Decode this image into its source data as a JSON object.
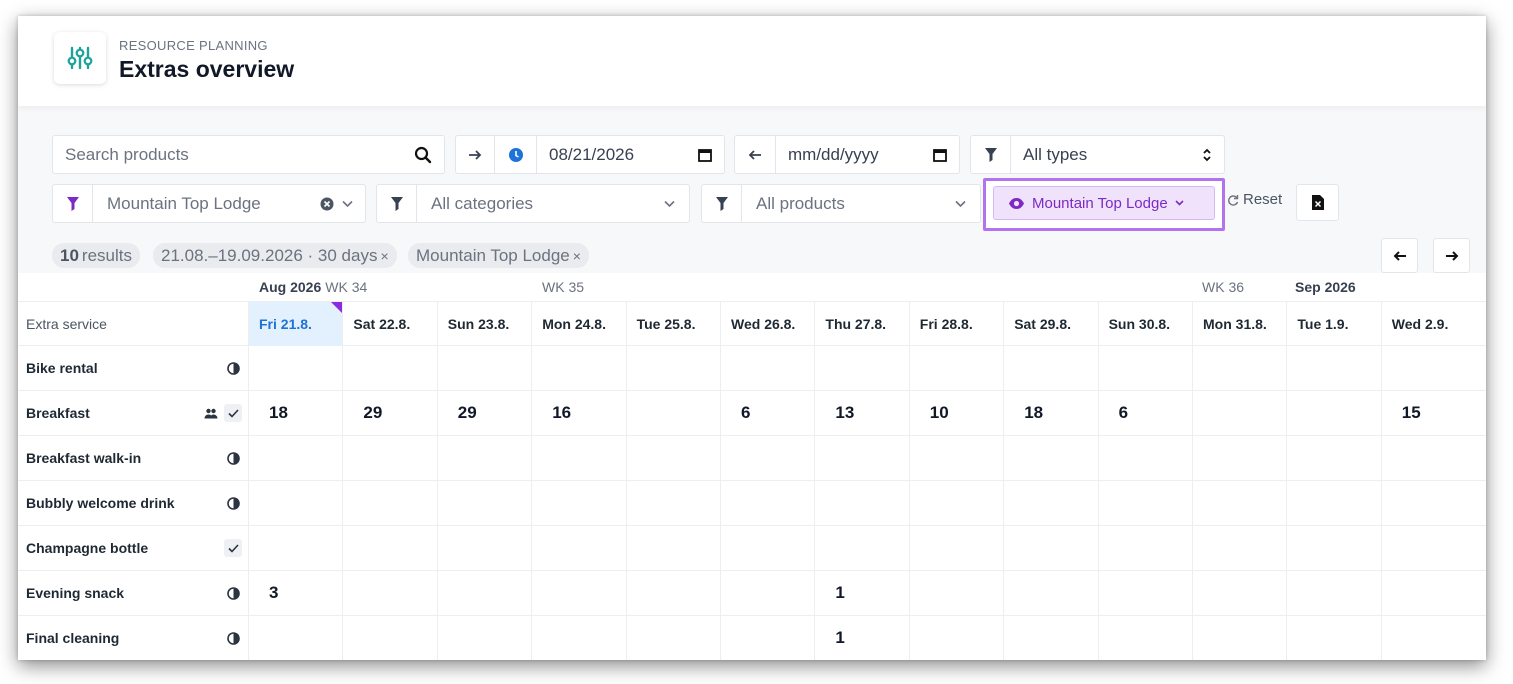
{
  "header": {
    "eyebrow": "RESOURCE PLANNING",
    "title": "Extras overview"
  },
  "filters": {
    "search_placeholder": "Search products",
    "from_date": "08/21/2026",
    "to_date_placeholder": "mm/dd/yyyy",
    "type_select": "All types",
    "property": "Mountain Top Lodge",
    "category_select": "All categories",
    "product_select": "All products",
    "view_button": "Mountain Top Lodge",
    "reset_label": "Reset"
  },
  "summary": {
    "count": "10",
    "results_label": "results",
    "date_range_tag": "21.08.–19.09.2026 · 30 days",
    "property_tag": "Mountain Top Lodge",
    "remove_glyph": "×"
  },
  "timeline": {
    "months": [
      {
        "month": "Aug 2026",
        "week": "WK 34"
      },
      {
        "month": "",
        "week": "WK 35"
      },
      {
        "month": "",
        "week": "WK 36"
      },
      {
        "month": "Sep 2026",
        "week": ""
      }
    ],
    "row_header": "Extra service",
    "days": [
      "Fri 21.8.",
      "Sat 22.8.",
      "Sun 23.8.",
      "Mon 24.8.",
      "Tue 25.8.",
      "Wed 26.8.",
      "Thu 27.8.",
      "Fri 28.8.",
      "Sat 29.8.",
      "Sun 30.8.",
      "Mon 31.8.",
      "Tue 1.9.",
      "Wed 2.9."
    ]
  },
  "rows": [
    {
      "name": "Bike rental",
      "icons": [
        "half-circle-icon"
      ],
      "values": [
        "",
        "",
        "",
        "",
        "",
        "",
        "",
        "",
        "",
        "",
        "",
        "",
        ""
      ]
    },
    {
      "name": "Breakfast",
      "icons": [
        "group-icon",
        "check-icon"
      ],
      "values": [
        "18",
        "29",
        "29",
        "16",
        "",
        "6",
        "13",
        "10",
        "18",
        "6",
        "",
        "",
        "15"
      ]
    },
    {
      "name": "Breakfast walk-in",
      "icons": [
        "half-circle-icon"
      ],
      "values": [
        "",
        "",
        "",
        "",
        "",
        "",
        "",
        "",
        "",
        "",
        "",
        "",
        ""
      ]
    },
    {
      "name": "Bubbly welcome drink",
      "icons": [
        "half-circle-icon"
      ],
      "values": [
        "",
        "",
        "",
        "",
        "",
        "",
        "",
        "",
        "",
        "",
        "",
        "",
        ""
      ]
    },
    {
      "name": "Champagne bottle",
      "icons": [
        "check-icon"
      ],
      "values": [
        "",
        "",
        "",
        "",
        "",
        "",
        "",
        "",
        "",
        "",
        "",
        "",
        ""
      ]
    },
    {
      "name": "Evening snack",
      "icons": [
        "half-circle-icon"
      ],
      "values": [
        "3",
        "",
        "",
        "",
        "",
        "",
        "1",
        "",
        "",
        "",
        "",
        "",
        ""
      ]
    },
    {
      "name": "Final cleaning",
      "icons": [
        "half-circle-icon"
      ],
      "values": [
        "",
        "",
        "",
        "",
        "",
        "",
        "1",
        "",
        "",
        "",
        "",
        "",
        ""
      ]
    }
  ],
  "colors": {
    "accent": "#7b2bc4",
    "highlight_border": "#b472ec",
    "today_bg": "#e3f0fd",
    "today_text": "#1d73d8",
    "brand_icon": "#1aa39a"
  }
}
